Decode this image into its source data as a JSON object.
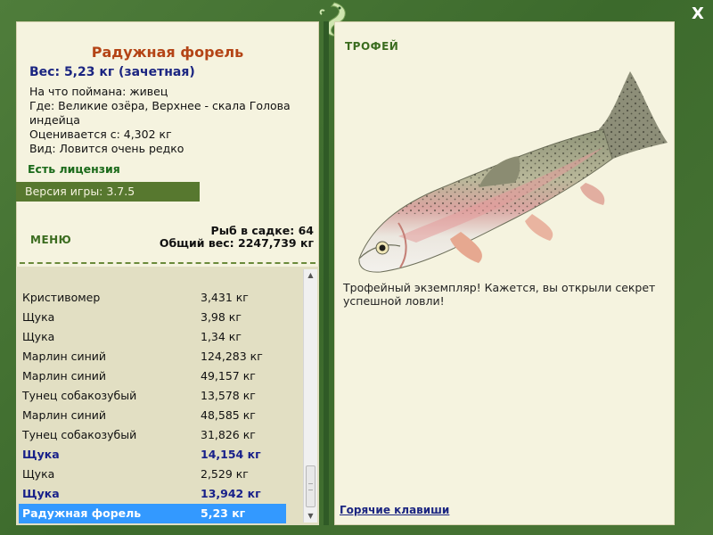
{
  "catch": {
    "title": "Радужная форель",
    "weight_line": "Вес: 5,23 кг (зачетная)",
    "bait": "На что поймана: живец",
    "location": "Где: Великие озёра, Верхнее - скала Голова индейца",
    "valued_from": "Оценивается с: 4,302 кг",
    "kind": "Вид: Ловится очень редко"
  },
  "license_text": "Есть лицензия",
  "version_text": "Версия игры: 3.7.5",
  "menu_label": "МЕНЮ",
  "cage": {
    "count_text": "Рыб в садке: 64",
    "total_text": "Общий вес: 2247,739 кг"
  },
  "fish_list": [
    {
      "name": "Кристивомер",
      "weight": "3,431 кг",
      "style": "normal"
    },
    {
      "name": "Щука",
      "weight": "3,98 кг",
      "style": "normal"
    },
    {
      "name": "Щука",
      "weight": "1,34 кг",
      "style": "normal"
    },
    {
      "name": "Марлин синий",
      "weight": "124,283 кг",
      "style": "normal"
    },
    {
      "name": "Марлин синий",
      "weight": "49,157 кг",
      "style": "normal"
    },
    {
      "name": "Тунец собакозубый",
      "weight": "13,578 кг",
      "style": "normal"
    },
    {
      "name": "Марлин синий",
      "weight": "48,585 кг",
      "style": "normal"
    },
    {
      "name": "Тунец собакозубый",
      "weight": "31,826 кг",
      "style": "normal"
    },
    {
      "name": "Щука",
      "weight": "14,154 кг",
      "style": "bold"
    },
    {
      "name": "Щука",
      "weight": "2,529 кг",
      "style": "normal"
    },
    {
      "name": "Щука",
      "weight": "13,942 кг",
      "style": "bold"
    },
    {
      "name": "Радужная форель",
      "weight": "5,23 кг",
      "style": "selected"
    }
  ],
  "trophy": {
    "label": "ТРОФЕЙ",
    "description": "Трофейный экземпляр! Кажется, вы открыли секрет успешной ловли!"
  },
  "hotkeys_link": "Горячие клавиши",
  "close_label": "X",
  "colors": {
    "frame": "#3f6c2f",
    "panel": "#f5f3df",
    "title": "#b44416",
    "weight": "#1b2581",
    "selected": "#3399ff",
    "version_bar": "#57782f"
  },
  "icons": [
    "lizard-logo-icon",
    "close-icon",
    "scroll-up-icon",
    "scroll-down-icon",
    "rainbow-trout-image"
  ]
}
